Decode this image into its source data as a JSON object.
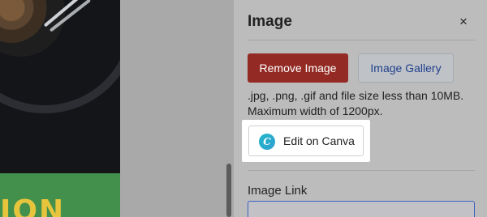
{
  "panel": {
    "title": "Image",
    "close_glyph": "×",
    "remove_label": "Remove Image",
    "gallery_label": "Image Gallery",
    "help_line1": ".jpg, .png, .gif and file size less than 10MB.",
    "help_line2": "Maximum width of 1200px.",
    "canva_glyph": "C",
    "canva_label": "Edit on Canva",
    "link_label": "Image Link",
    "link_value": ""
  },
  "preview": {
    "banner_text": "ION"
  },
  "colors": {
    "remove_button": "#932b24",
    "gallery_text": "#203f8c",
    "canva_teal": "#23b7c9",
    "input_border": "#3b62c2"
  },
  "icons": {
    "close": "close-icon",
    "canva": "canva-logo-icon"
  }
}
